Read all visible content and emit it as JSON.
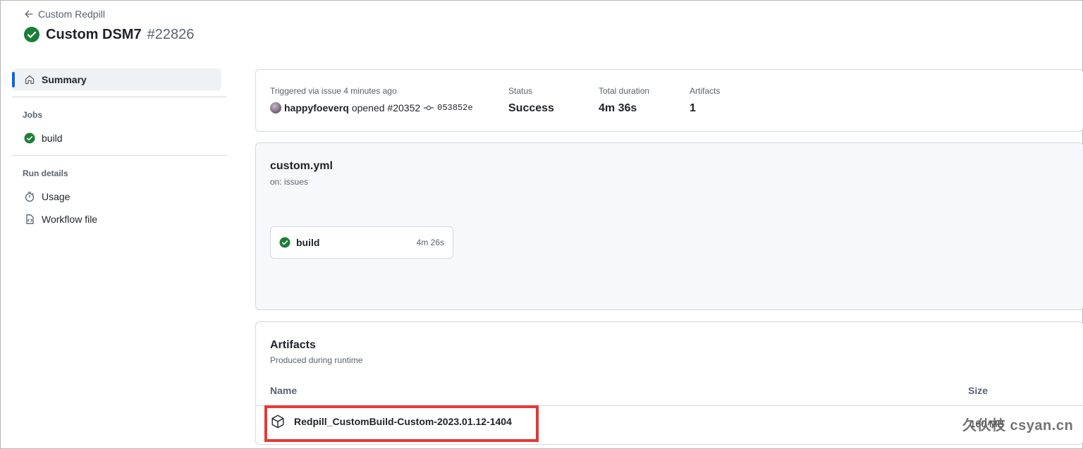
{
  "header": {
    "back_label": "Custom Redpill",
    "title": "Custom DSM7",
    "run_number": "#22826"
  },
  "sidebar": {
    "summary_label": "Summary",
    "jobs_heading": "Jobs",
    "jobs": [
      {
        "label": "build",
        "status": "success"
      }
    ],
    "run_details_heading": "Run details",
    "run_details": [
      {
        "label": "Usage",
        "icon": "stopwatch-icon"
      },
      {
        "label": "Workflow file",
        "icon": "file-code-icon"
      }
    ]
  },
  "summary": {
    "trigger_label": "Triggered via issue 4 minutes ago",
    "user": "happyfoeverq",
    "action": "opened #20352",
    "commit_sha": "053852e",
    "status_label": "Status",
    "status_value": "Success",
    "duration_label": "Total duration",
    "duration_value": "4m 36s",
    "artifacts_label": "Artifacts",
    "artifacts_value": "1"
  },
  "workflow": {
    "file": "custom.yml",
    "trigger": "on: issues",
    "job_name": "build",
    "job_duration": "4m 26s"
  },
  "artifacts": {
    "title": "Artifacts",
    "subtitle": "Produced during runtime",
    "col_name": "Name",
    "col_size": "Size",
    "items": [
      {
        "name": "Redpill_CustomBuild-Custom-2023.01.12-1404",
        "size": "160 MB"
      }
    ]
  },
  "watermark": "久伙枝 csyan.cn",
  "colors": {
    "success": "#1a7f37",
    "accent": "#0969da",
    "highlight": "#e53935"
  }
}
